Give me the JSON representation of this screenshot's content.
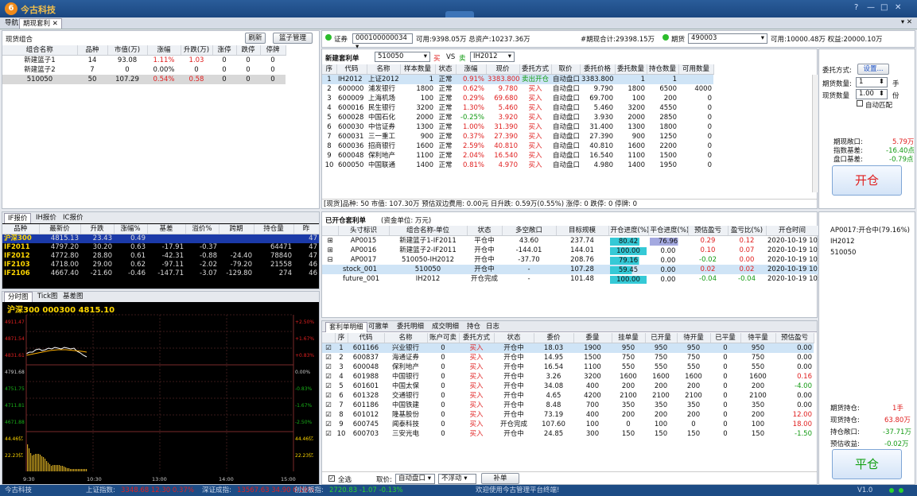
{
  "app": {
    "title": "今古科技",
    "win_controls": [
      "?",
      "—",
      "□",
      "✕"
    ]
  },
  "tabs": [
    {
      "label": "导航"
    },
    {
      "label": "期现套利 ✕"
    }
  ],
  "tab_close": "▾ ✕",
  "portfolio": {
    "title": "现货组合",
    "refresh": "刷新",
    "basket_btn": "篮子管理",
    "headers": [
      "组合名称",
      "品种",
      "市值(万)",
      "涨幅",
      "升跌(万)",
      "涨停",
      "跌停",
      "停牌"
    ],
    "rows": [
      [
        "新建篮子1",
        "14",
        "93.08",
        "1.11%",
        "1.03",
        "0",
        "0",
        "0"
      ],
      [
        "新建篮子2",
        "7",
        "0",
        "0.00%",
        "0",
        "0",
        "0",
        "0"
      ],
      [
        "510050",
        "50",
        "107.29",
        "0.54%",
        "0.58",
        "0",
        "0",
        "0"
      ]
    ]
  },
  "if_quote": {
    "tabs": [
      "IF报价",
      "IH报价",
      "IC报价"
    ],
    "headers": [
      "品种",
      "最新价",
      "升跌",
      "涨幅%",
      "基差",
      "溢价%",
      "跨期",
      "持仓量",
      "昨"
    ],
    "rows": [
      [
        "沪深300",
        "4815.13",
        "23.43",
        "0.49",
        "",
        "",
        "",
        "",
        "47"
      ],
      [
        "IF2011",
        "4797.20",
        "30.20",
        "0.63",
        "-17.91",
        "-0.37",
        "",
        "64471",
        "47"
      ],
      [
        "IF2012",
        "4772.80",
        "28.80",
        "0.61",
        "-42.31",
        "-0.88",
        "-24.40",
        "78840",
        "47"
      ],
      [
        "IF2103",
        "4718.00",
        "29.00",
        "0.62",
        "-97.11",
        "-2.02",
        "-79.20",
        "21558",
        "46"
      ],
      [
        "IF2106",
        "4667.40",
        "-21.60",
        "-0.46",
        "-147.71",
        "-3.07",
        "-129.80",
        "274",
        "46"
      ]
    ]
  },
  "minute_chart": {
    "tabs": [
      "分时图",
      "Tick图",
      "基差图"
    ],
    "header": "沪深300  000300  4815.10",
    "y_left": [
      "4911.47",
      "4871.54",
      "4831.61",
      "4791.68",
      "4751.75",
      "4711.81",
      "4671.88",
      "",
      "44.46亿",
      "22.23亿"
    ],
    "y_right": [
      "+2.50%",
      "+1.67%",
      "+0.83%",
      "0.00%",
      "-0.83%",
      "-1.67%",
      "-2.50%",
      "",
      "44.46亿",
      "22.23亿"
    ],
    "x": [
      "9:30",
      "10:30",
      "13:00",
      "14:00",
      "15:00"
    ]
  },
  "account": {
    "stock_label": "证券",
    "stock_acct": "000100000034",
    "stock_info": "可用:9398.05万 总资产:10237.36万",
    "period_total": "#期现合计:29398.15万",
    "fut_label": "期货",
    "fut_acct": "490003",
    "fut_info": "可用:10000.48万 权益:20000.10万"
  },
  "arb": {
    "title": "新建套利单",
    "left": "510050",
    "buy": "买",
    "vs": "VS",
    "sell": "卖",
    "right": "IH2012",
    "headers": [
      "序",
      "代码",
      "名称",
      "样本数量",
      "状态",
      "涨幅",
      "现价",
      "委托方式",
      "取价",
      "委托价格",
      "委托数量",
      "持仓数量",
      "可用数量"
    ],
    "rows": [
      [
        "1",
        "IH2012",
        "上证2012",
        "1",
        "正常",
        "0.91%",
        "3383.800",
        "卖出开仓",
        "自动盘口",
        "3383.800",
        "1",
        "1",
        ""
      ],
      [
        "2",
        "600000",
        "浦发银行",
        "1800",
        "正常",
        "0.62%",
        "9.780",
        "买入",
        "自动盘口",
        "9.790",
        "1800",
        "6500",
        "4000"
      ],
      [
        "3",
        "600009",
        "上海机场",
        "100",
        "正常",
        "0.29%",
        "69.680",
        "买入",
        "自动盘口",
        "69.700",
        "100",
        "200",
        "0"
      ],
      [
        "4",
        "600016",
        "民生银行",
        "3200",
        "正常",
        "1.30%",
        "5.460",
        "买入",
        "自动盘口",
        "5.460",
        "3200",
        "4550",
        "0"
      ],
      [
        "5",
        "600028",
        "中国石化",
        "2000",
        "正常",
        "-0.25%",
        "3.920",
        "买入",
        "自动盘口",
        "3.930",
        "2000",
        "2850",
        "0"
      ],
      [
        "6",
        "600030",
        "中信证券",
        "1300",
        "正常",
        "1.00%",
        "31.390",
        "买入",
        "自动盘口",
        "31.400",
        "1300",
        "1800",
        "0"
      ],
      [
        "7",
        "600031",
        "三一重工",
        "900",
        "正常",
        "0.37%",
        "27.390",
        "买入",
        "自动盘口",
        "27.390",
        "900",
        "1250",
        "0"
      ],
      [
        "8",
        "600036",
        "招商银行",
        "1600",
        "正常",
        "2.59%",
        "40.810",
        "买入",
        "自动盘口",
        "40.810",
        "1600",
        "2200",
        "0"
      ],
      [
        "9",
        "600048",
        "保利地产",
        "1100",
        "正常",
        "2.04%",
        "16.540",
        "买入",
        "自动盘口",
        "16.540",
        "1100",
        "1500",
        "0"
      ],
      [
        "10",
        "600050",
        "中国联通",
        "1400",
        "正常",
        "0.81%",
        "4.970",
        "买入",
        "自动盘口",
        "4.980",
        "1400",
        "1950",
        "0"
      ]
    ],
    "summary": "[现货]品种: 50 市值: 107.30万 预估双边费用: 0.00元 日升跌: 0.59万(0.55%) 涨停: 0 跌停: 0 停牌: 0"
  },
  "side": {
    "method_label": "委托方式:",
    "method_btn": "设置...",
    "fut_qty_label": "期货数量:",
    "fut_qty": "1",
    "fut_unit": "手",
    "stock_qty_label": "现货数量",
    "stock_qty": "1.00",
    "stock_unit": "份",
    "auto_match": "自动匹配",
    "exposure_label": "期现敞口:",
    "exposure": "5.79万",
    "basis_label": "指数基差:",
    "basis": "-16.40点",
    "pk_label": "盘口基差:",
    "pk": "-0.79点",
    "open_btn": "开仓",
    "info": [
      "AP0017:开仓中(79.16%)",
      "IH2012",
      "510050"
    ],
    "hold_fut_label": "期货持仓:",
    "hold_fut": "1手",
    "hold_stock_label": "现货持仓:",
    "hold_stock": "63.80万",
    "hold_exp_label": "持仓敞口:",
    "hold_exp": "-37.71万",
    "est_label": "预估收益:",
    "est": "-0.02万",
    "close_btn": "平仓"
  },
  "opened": {
    "title": "已开仓套利单",
    "unit": "(资金单位: 万元)",
    "headers": [
      "",
      "头寸标识",
      "组合名称-单位",
      "状态",
      "多空敞口",
      "目标规模",
      "开仓进度(%)",
      "平仓进度(%)",
      "预估盈亏",
      "盈亏比(%)",
      "开仓时间"
    ],
    "rows": [
      [
        "⊞",
        "AP0015",
        "新建篮子1-IF2011",
        "平仓中",
        "43.60",
        "237.74",
        "80.42",
        "76.96",
        "0.29",
        "0.12",
        "2020-10-19 10:16:442"
      ],
      [
        "⊞",
        "AP0016",
        "新建篮子2-IF2011",
        "开仓中",
        "-144.01",
        "144.01",
        "100.00",
        "0.00",
        "0.10",
        "0.07",
        "2020-10-19 10:21:400"
      ],
      [
        "⊟",
        "AP0017",
        "510050-IH2012",
        "开仓中",
        "-37.70",
        "208.76",
        "79.16",
        "0.00",
        "-0.02",
        "0.00",
        "2020-10-19 10:28:150"
      ],
      [
        "",
        "stock_001",
        "510050",
        "开仓中",
        "-",
        "107.28",
        "59.45",
        "0.00",
        "0.02",
        "0.02",
        "2020-10-19 10:28:150"
      ],
      [
        "",
        "future_001",
        "IH2012",
        "开仓完成",
        "-",
        "101.48",
        "100.00",
        "0.00",
        "-0.04",
        "-0.04",
        "2020-10-19 10:28:150"
      ]
    ]
  },
  "detail": {
    "tabs": [
      "套利单明细",
      "可撤单",
      "委托明细",
      "成交明细",
      "持仓",
      "日志"
    ],
    "headers": [
      "",
      "序",
      "代码",
      "名称",
      "账户可卖",
      "委托方式",
      "状态",
      "委价",
      "委量",
      "挂单量",
      "已开量",
      "待开量",
      "已平量",
      "待平量",
      "预估盈亏"
    ],
    "rows": [
      [
        "☑",
        "1",
        "601166",
        "兴业银行",
        "0",
        "买入",
        "开仓中",
        "18.03",
        "1900",
        "950",
        "950",
        "950",
        "0",
        "950",
        "0.00"
      ],
      [
        "☑",
        "2",
        "600837",
        "海通证券",
        "0",
        "买入",
        "开仓中",
        "14.95",
        "1500",
        "750",
        "750",
        "750",
        "0",
        "750",
        "0.00"
      ],
      [
        "☑",
        "3",
        "600048",
        "保利地产",
        "0",
        "买入",
        "开仓中",
        "16.54",
        "1100",
        "550",
        "550",
        "550",
        "0",
        "550",
        "0.00"
      ],
      [
        "☑",
        "4",
        "601988",
        "中国银行",
        "0",
        "买入",
        "开仓中",
        "3.26",
        "3200",
        "1600",
        "1600",
        "1600",
        "0",
        "1600",
        "0.16"
      ],
      [
        "☑",
        "5",
        "601601",
        "中国太保",
        "0",
        "买入",
        "开仓中",
        "34.08",
        "400",
        "200",
        "200",
        "200",
        "0",
        "200",
        "-4.00"
      ],
      [
        "☑",
        "6",
        "601328",
        "交通银行",
        "0",
        "买入",
        "开仓中",
        "4.65",
        "4200",
        "2100",
        "2100",
        "2100",
        "0",
        "2100",
        "0.00"
      ],
      [
        "☑",
        "7",
        "601186",
        "中国铁建",
        "0",
        "买入",
        "开仓中",
        "8.48",
        "700",
        "350",
        "350",
        "350",
        "0",
        "350",
        "0.00"
      ],
      [
        "☑",
        "8",
        "601012",
        "隆基股份",
        "0",
        "买入",
        "开仓中",
        "73.19",
        "400",
        "200",
        "200",
        "200",
        "0",
        "200",
        "12.00"
      ],
      [
        "☑",
        "9",
        "600745",
        "闻泰科技",
        "0",
        "买入",
        "开仓完成",
        "107.60",
        "100",
        "0",
        "100",
        "0",
        "0",
        "100",
        "18.00"
      ],
      [
        "☑",
        "10",
        "600703",
        "三安光电",
        "0",
        "买入",
        "开仓中",
        "24.85",
        "300",
        "150",
        "150",
        "150",
        "0",
        "150",
        "-1.50"
      ]
    ],
    "select_all": "全选",
    "price_label": "取价:",
    "price_val": "自动盘口",
    "float_val": "不浮动",
    "supplement": "补单"
  },
  "status": {
    "company": "今古科技",
    "sh": "上证指数:",
    "sh_val": "3348.68 12.30 0.37%",
    "sz": "深证成指:",
    "sz_val": "13567.63 34.90 0.26%",
    "cy": "创业板指:",
    "cy_val": "2720.83 -1.07 -0.13%",
    "welcome": "欢迎使用今古管理平台终端!",
    "ver": "V1.0"
  }
}
